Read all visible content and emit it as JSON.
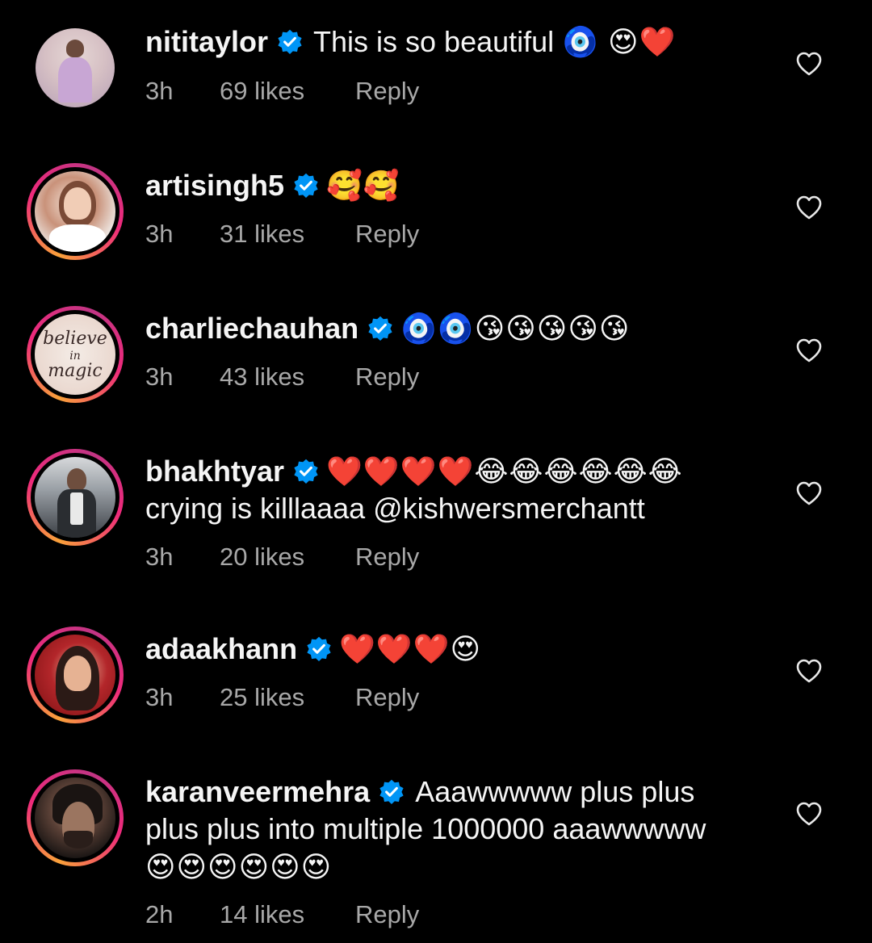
{
  "comments": [
    {
      "username": "nititaylor",
      "text": "This is so beautiful",
      "emojis": "🧿 😍❤️",
      "time": "3h",
      "likes": "69 likes",
      "reply": "Reply",
      "avatar_ring": false
    },
    {
      "username": "artisingh5",
      "text": "",
      "emojis": "🥰🥰",
      "time": "3h",
      "likes": "31 likes",
      "reply": "Reply",
      "avatar_ring": true
    },
    {
      "username": "charliechauhan",
      "text": "",
      "emojis": "🧿🧿😘😘😘😘😘",
      "time": "3h",
      "likes": "43 likes",
      "reply": "Reply",
      "avatar_ring": true,
      "avatar_text": [
        "believe",
        "in",
        "magic"
      ]
    },
    {
      "username": "bhakhtyar",
      "text": "",
      "emojis": "❤️❤️❤️❤️😂😂😂😂😂😂",
      "text_line2": "crying is killlaaaa @kishwersmerchantt",
      "time": "3h",
      "likes": "20 likes",
      "reply": "Reply",
      "avatar_ring": true
    },
    {
      "username": "adaakhann",
      "text": "",
      "emojis": "❤️❤️❤️😍",
      "time": "3h",
      "likes": "25 likes",
      "reply": "Reply",
      "avatar_ring": true
    },
    {
      "username": "karanveermehra",
      "text": "Aaawwwww plus plus",
      "emojis": "",
      "text_line2": "plus plus into multiple 1000000 aaawwwww",
      "text_line3": "😍😍😍😍😍😍",
      "time": "2h",
      "likes": "14 likes",
      "reply": "Reply",
      "avatar_ring": true
    }
  ],
  "icons": {
    "verified": "verified-badge-icon",
    "like": "heart-outline-icon"
  },
  "colors": {
    "background": "#000000",
    "text": "#f5f5f5",
    "meta": "#a8a8a8",
    "verified": "#0095f6",
    "ring_start": "#f9a13a",
    "ring_end": "#c13584"
  }
}
